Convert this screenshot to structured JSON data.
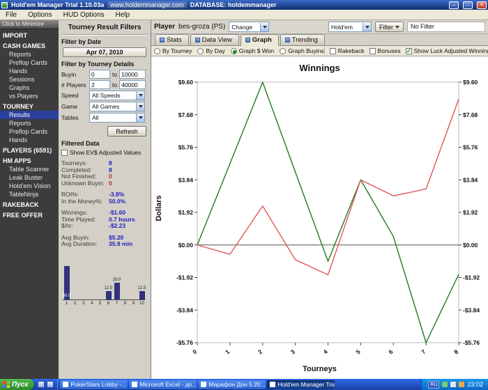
{
  "titlebar": {
    "title": "Hold'em Manager Trial 1.10.03a",
    "site": "www.holdemmanager.com",
    "database_label": "DATABASE: holdemmanager"
  },
  "menubar": {
    "items": [
      "File",
      "Options",
      "HUD Options",
      "Help"
    ]
  },
  "sidebar": {
    "minimize_label": "Click to Minimize",
    "entries": [
      {
        "label": "IMPORT",
        "type": "header",
        "selected": false
      },
      {
        "label": "CASH GAMES",
        "type": "header",
        "selected": false
      },
      {
        "label": "Reports",
        "type": "item",
        "selected": false
      },
      {
        "label": "Preflop Cards",
        "type": "item",
        "selected": false
      },
      {
        "label": "Hands",
        "type": "item",
        "selected": false
      },
      {
        "label": "Sessions",
        "type": "item",
        "selected": false
      },
      {
        "label": "Graphs",
        "type": "item",
        "selected": false
      },
      {
        "label": "vs Players",
        "type": "item",
        "selected": false
      },
      {
        "label": "TOURNEY",
        "type": "header",
        "selected": false
      },
      {
        "label": "Results",
        "type": "item",
        "selected": true
      },
      {
        "label": "Reports",
        "type": "item",
        "selected": false
      },
      {
        "label": "Preflop Cards",
        "type": "item",
        "selected": false
      },
      {
        "label": "Hands",
        "type": "item",
        "selected": false
      },
      {
        "label": "PLAYERS (6591)",
        "type": "header",
        "selected": false
      },
      {
        "label": "HM APPS",
        "type": "header",
        "selected": false
      },
      {
        "label": "Table Scanner",
        "type": "item",
        "selected": false
      },
      {
        "label": "Leak Buster",
        "type": "item",
        "selected": false
      },
      {
        "label": "Hold'em Vision",
        "type": "item",
        "selected": false
      },
      {
        "label": "TableNinja",
        "type": "item",
        "selected": false
      },
      {
        "label": "RAKEBACK",
        "type": "header",
        "selected": false
      },
      {
        "label": "FREE OFFER",
        "type": "header",
        "selected": false
      }
    ]
  },
  "filter_panel": {
    "title": "Tourney Result Filters",
    "date_header": "Filter by Date",
    "date_value": "Apr 07, 2010",
    "details_header": "Filter by Tourney Details",
    "rows": {
      "buyin_label": "Buyin",
      "buyin_from": "0",
      "to": "to",
      "buyin_to": "10000",
      "players_label": "# Players",
      "players_from": "2",
      "players_to": "40000",
      "speed_label": "Speed",
      "speed_value": "All Speeds",
      "game_label": "Game",
      "game_value": "All Games",
      "tables_label": "Tables",
      "tables_value": "All"
    },
    "refresh_label": "Refresh",
    "filtered_header": "Filtered Data",
    "ev_checkbox_label": "Show EV$ Adjusted Values",
    "stat_groups": [
      [
        {
          "label": "Tourneys:",
          "value": "8",
          "color": "blue"
        },
        {
          "label": "Completed:",
          "value": "8",
          "color": "blue"
        },
        {
          "label": "Not Finished:",
          "value": "0",
          "color": "red"
        },
        {
          "label": "Unknown Buyin:",
          "value": "0",
          "color": "red"
        }
      ],
      [
        {
          "label": "ROI%:",
          "value": "-3.8%",
          "color": "blue"
        },
        {
          "label": "In the Money%:",
          "value": "50.0%",
          "color": "blue"
        }
      ],
      [
        {
          "label": "Winnings:",
          "value": "-$1.60",
          "color": "blue"
        },
        {
          "label": "Time Played:",
          "value": "0.7 hours",
          "color": "blue"
        },
        {
          "label": "$/hr:",
          "value": "-$2.23",
          "color": "blue"
        }
      ],
      [
        {
          "label": "Avg Buyin:",
          "value": "$5.20",
          "color": "blue"
        },
        {
          "label": "Avg Duration:",
          "value": "35.9 min",
          "color": "blue"
        }
      ]
    ]
  },
  "mini_chart": {
    "type": "bar",
    "categories": [
      "1",
      "2",
      "3",
      "4",
      "5",
      "6",
      "7",
      "8",
      "9",
      "10"
    ],
    "values": [
      50.0,
      0,
      0,
      0,
      0,
      12.5,
      25.0,
      0,
      0,
      12.5
    ],
    "bar_labels": [
      "50.0",
      "",
      "",
      "",
      "",
      "12.5",
      "25.0",
      "",
      "",
      "12.5"
    ],
    "color": "#31317e"
  },
  "player_bar": {
    "player_label": "Player",
    "player_name": "bes-groza (PS)",
    "change_label": "Change",
    "game_select": "Hold'em",
    "filter_button": "Filter",
    "filter_status": "No Filter"
  },
  "tabs": [
    {
      "label": "Stats",
      "active": false
    },
    {
      "label": "Data View",
      "active": false
    },
    {
      "label": "Graph",
      "active": true
    },
    {
      "label": "Trending",
      "active": false
    }
  ],
  "graph_options": {
    "radios": [
      {
        "label": "By Tourney",
        "selected": false
      },
      {
        "label": "By Day",
        "selected": false
      },
      {
        "label": "Graph $ Won",
        "selected": true
      },
      {
        "label": "Graph Buyins",
        "selected": false
      }
    ],
    "checkboxes": [
      {
        "label": "Rakeback",
        "checked": false
      },
      {
        "label": "Bonuses",
        "checked": false
      },
      {
        "label": "Show Luck Adjusted Winnings",
        "checked": true
      }
    ]
  },
  "chart_data": {
    "type": "line",
    "title": "Winnings",
    "xlabel": "Tourneys",
    "ylabel": "Dollars",
    "x": [
      0,
      1,
      2,
      3,
      4,
      5,
      6,
      7,
      8
    ],
    "series": [
      {
        "name": "$ Won",
        "color": "#1f7a1f",
        "values": [
          0,
          4.8,
          9.6,
          4.3,
          -0.96,
          3.84,
          0.5,
          -5.76,
          -1.73
        ]
      },
      {
        "name": "Luck Adjusted Winnings",
        "color": "#e25555",
        "values": [
          0,
          -0.55,
          2.3,
          -0.87,
          -1.76,
          3.84,
          2.9,
          3.3,
          8.6
        ]
      }
    ],
    "xlim": [
      0,
      8
    ],
    "ylim": [
      -5.76,
      9.6
    ],
    "xticks": [
      0,
      1,
      2,
      3,
      4,
      5,
      6,
      7,
      8
    ],
    "yticks": [
      9.6,
      7.68,
      5.76,
      3.84,
      1.92,
      0,
      -1.92,
      -3.84,
      -5.76
    ],
    "ytick_labels": [
      "$9.60",
      "$7.68",
      "$5.76",
      "$3.84",
      "$1.92",
      "$0.00",
      "-$1.92",
      "-$3.84",
      "-$5.76"
    ],
    "grid": false,
    "zero_line": true,
    "legend_position": "none"
  },
  "taskbar": {
    "start_label": "Пуск",
    "buttons": [
      {
        "label": "PokerStars Lobby -...",
        "active": false
      },
      {
        "label": "Microsoft Excel - до...",
        "active": false
      },
      {
        "label": "Марафон Дон 5.20...",
        "active": false
      },
      {
        "label": "Hold'em Manager Tria...",
        "active": true
      }
    ],
    "tray_lang": "RU",
    "tray_time": "23:02"
  }
}
